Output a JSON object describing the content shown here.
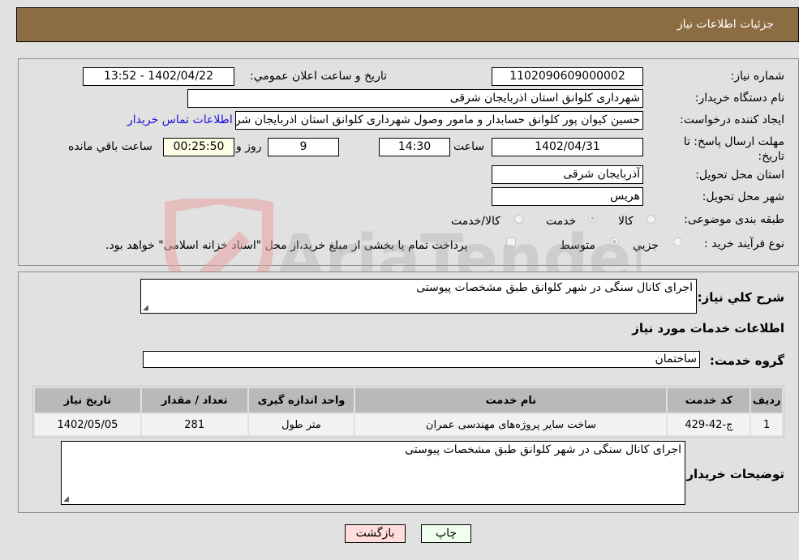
{
  "header": {
    "title": "جزئیات اطلاعات نیاز"
  },
  "form": {
    "need_number": {
      "label": "شماره نیاز:",
      "value": "1102090609000002"
    },
    "announce_datetime": {
      "label": "تاریخ و ساعت اعلان عمومي:",
      "value": "1402/04/22 - 13:52"
    },
    "buyer_org": {
      "label": "نام دستگاه خريدار:",
      "value": "شهرداری کلوانق استان اذربایجان شرقی"
    },
    "requester": {
      "label": "ایجاد کننده درخواست:",
      "value": "حسین  کیوان پور کلوانق حسابدار و مامور وصول شهرداری کلوانق استان اذربایجان شرقی",
      "contact_link": "اطلاعات تماس خریدار"
    },
    "deadline": {
      "label": "مهلت ارسال پاسخ: تا تاریخ:",
      "date": "1402/04/31",
      "time_label": "ساعت",
      "time": "14:30",
      "days": "9",
      "days_label": "روز و",
      "remaining": "00:25:50",
      "remaining_label": "ساعت باقي مانده"
    },
    "province": {
      "label": "استان محل تحویل:",
      "value": "آذربایجان شرقی"
    },
    "city": {
      "label": "شهر محل تحویل:",
      "value": "هریس"
    },
    "category": {
      "label": "طبقه بندی موضوعی:",
      "options": [
        "کالا",
        "خدمت",
        "کالا/خدمت"
      ],
      "selected": "خدمت"
    },
    "purchase_type": {
      "label": "نوع فرآیند خرید :",
      "options": [
        "جزیي",
        "متوسط"
      ],
      "selected": "متوسط",
      "treasury_note": "پرداخت تمام یا بخشی از مبلغ خرید،از محل \"اسناد خزانه اسلامی\" خواهد بود."
    }
  },
  "details": {
    "general_desc": {
      "label": "شرح کلي نیاز:",
      "value": "اجرای کانال سنگی در شهر کلوانق طبق مشخصات پیوستی"
    },
    "services_title": "اطلاعات خدمات مورد نیاز",
    "service_group": {
      "label": "گروه خدمت:",
      "value": "ساختمان"
    },
    "table": {
      "headers": [
        "ردیف",
        "کد خدمت",
        "نام خدمت",
        "واحد اندازه گیری",
        "تعداد / مقدار",
        "تاریخ نیاز"
      ],
      "rows": [
        [
          "1",
          "ج-42-429",
          "ساخت سایر پروژه‌های مهندسی عمران",
          "متر طول",
          "281",
          "1402/05/05"
        ]
      ]
    },
    "buyer_notes": {
      "label": "توضیحات خریدار:",
      "value": "اجرای کانال سنگی در شهر کلوانق طبق مشخصات پیوستی"
    }
  },
  "buttons": {
    "print": "چاپ",
    "back": "بازگشت"
  },
  "watermark": {
    "text": "AriaTender.neT"
  },
  "colors": {
    "header_bg": "#8c6c42",
    "print_bg": "#eeffee",
    "back_bg": "#ffdddd",
    "link": "#1a0dd8"
  }
}
